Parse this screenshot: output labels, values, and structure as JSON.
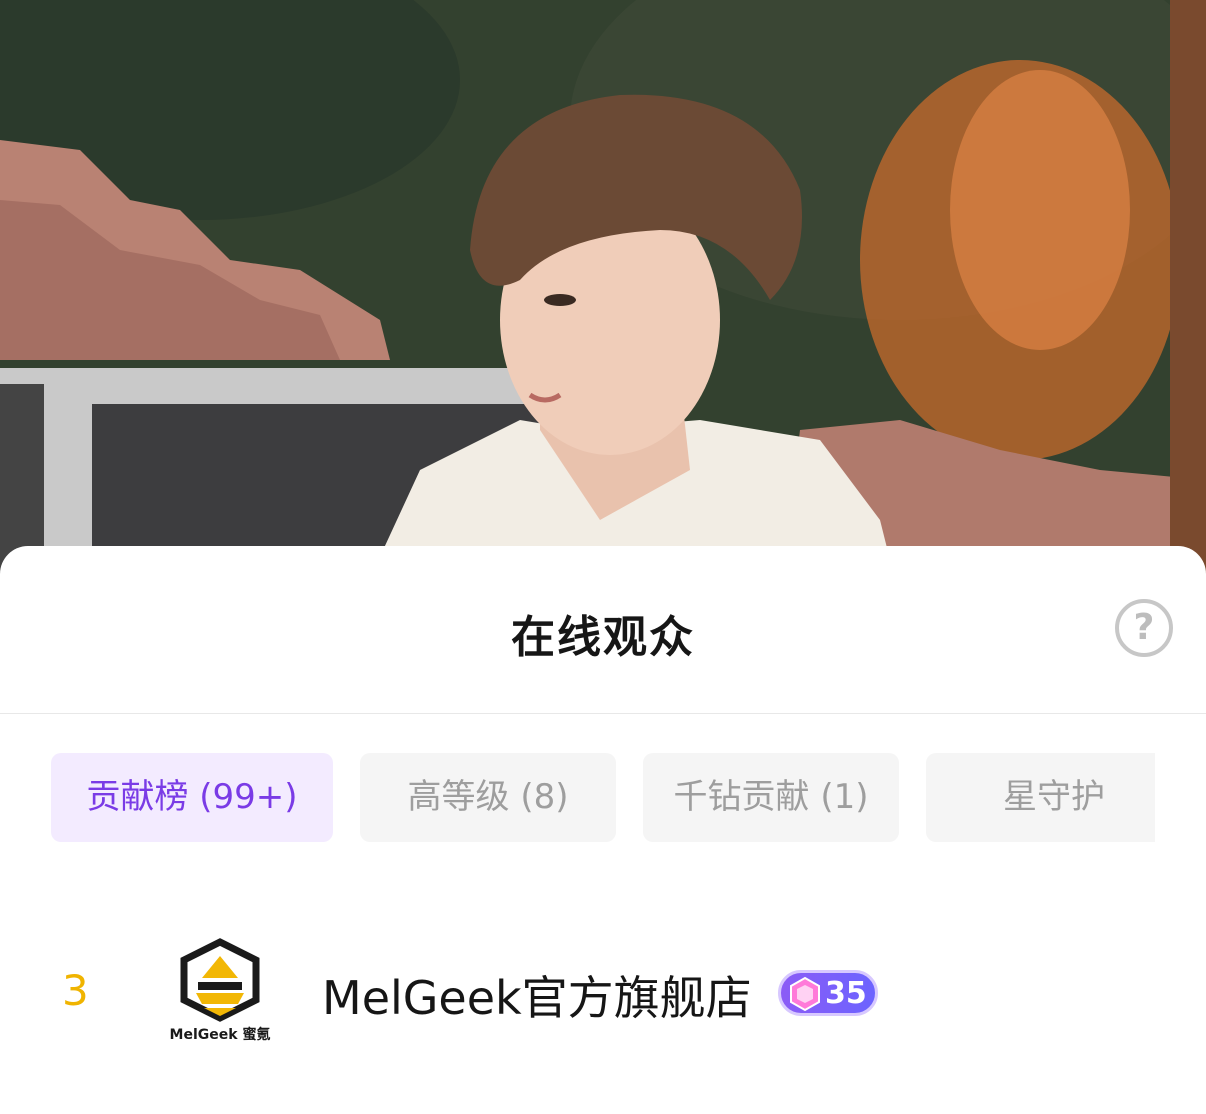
{
  "sheet": {
    "title": "在线观众",
    "help_icon": "question-circle-icon"
  },
  "tabs": [
    {
      "label": "贡献榜 (99+)",
      "active": true
    },
    {
      "label": "高等级 (8)",
      "active": false
    },
    {
      "label": "千钻贡献 (1)",
      "active": false
    },
    {
      "label": "星守护",
      "active": false
    }
  ],
  "list": [
    {
      "rank": "3",
      "avatar_caption": "MelGeek 蜜氪",
      "name": "MelGeek官方旗舰店",
      "level": "35"
    }
  ],
  "colors": {
    "accent": "#7a3be6",
    "active_tab_bg": "#f3ebff",
    "rank_color": "#f0b400",
    "badge": "#7c5cf6"
  }
}
